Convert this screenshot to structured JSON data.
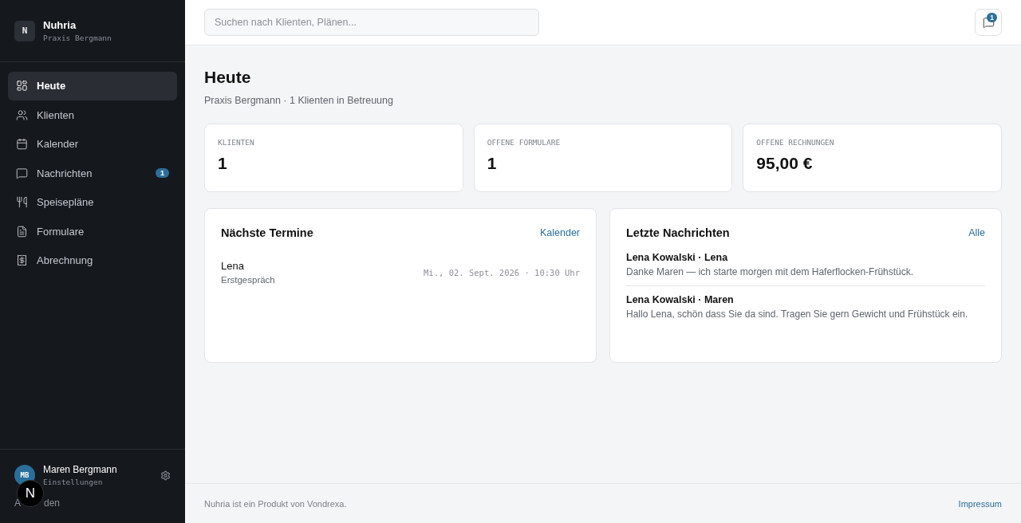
{
  "brand": {
    "logo": "N",
    "name": "Nuhria",
    "subtitle": "Praxis Bergmann"
  },
  "sidebar": {
    "items": [
      {
        "label": "Heute",
        "selected": true
      },
      {
        "label": "Klienten",
        "selected": false
      },
      {
        "label": "Kalender",
        "selected": false
      },
      {
        "label": "Nachrichten",
        "selected": false,
        "badge": "1"
      },
      {
        "label": "Speisepläne",
        "selected": false
      },
      {
        "label": "Formulare",
        "selected": false
      },
      {
        "label": "Abrechnung",
        "selected": false
      }
    ]
  },
  "user": {
    "initials": "MB",
    "name": "Maren Bergmann",
    "link": "Einstellungen",
    "logout_visible_parts": [
      "A",
      "den"
    ]
  },
  "dev_badge": {
    "letter": "N"
  },
  "search": {
    "placeholder": "Suchen nach Klienten, Plänen..."
  },
  "notifications": {
    "count": "1"
  },
  "page": {
    "title": "Heute",
    "subtitle": "Praxis Bergmann · 1 Klienten in Betreuung"
  },
  "stats": [
    {
      "label": "KLIENTEN",
      "value": "1"
    },
    {
      "label": "OFFENE FORMULARE",
      "value": "1"
    },
    {
      "label": "OFFENE RECHNUNGEN",
      "value": "95,00 €"
    }
  ],
  "appointments": {
    "title": "Nächste Termine",
    "link": "Kalender",
    "items": [
      {
        "name": "Lena",
        "type": "Erstgespräch",
        "when": "Mi., 02. Sept. 2026 · 10:30 Uhr"
      }
    ]
  },
  "messages": {
    "title": "Letzte Nachrichten",
    "link": "Alle",
    "items": [
      {
        "from": "Lena Kowalski · Lena",
        "text": "Danke Maren — ich starte morgen mit dem Haferflocken-Frühstück."
      },
      {
        "from": "Lena Kowalski · Maren",
        "text": "Hallo Lena, schön dass Sie da sind. Tragen Sie gern Gewicht und Frühstück ein."
      }
    ]
  },
  "footer": {
    "text": "Nuhria ist ein Produkt von Vondrexa.",
    "link": "Impressum"
  }
}
